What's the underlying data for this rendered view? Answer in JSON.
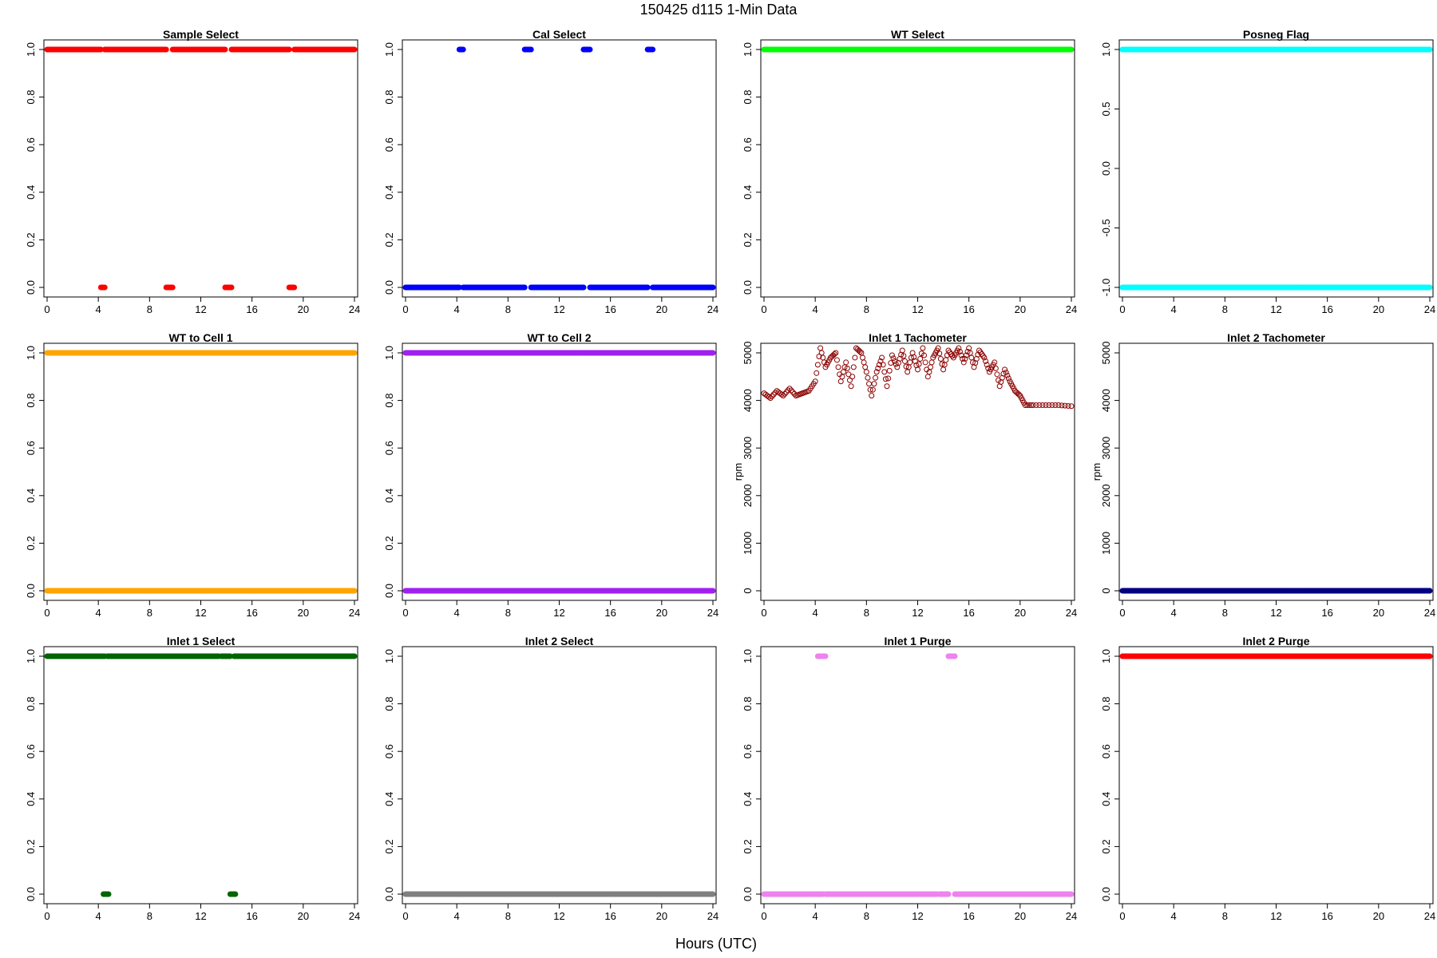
{
  "figure": {
    "title": "150425   d115   1-Min Data",
    "xlabel": "Hours (UTC)"
  },
  "chart_data": [
    {
      "type": "scatter",
      "title": "Sample Select",
      "color": "#ff0000",
      "xlim": [
        0,
        24
      ],
      "ylim": [
        0,
        1
      ],
      "xticks": [
        0,
        4,
        8,
        12,
        16,
        20,
        24
      ],
      "yticks": [
        0.0,
        0.2,
        0.4,
        0.6,
        0.8,
        1.0
      ],
      "ytick_decimals": 1,
      "ylabel": "",
      "segments": [
        {
          "y": 1,
          "x": [
            [
              0,
              4.2
            ],
            [
              4.5,
              9.3
            ],
            [
              9.8,
              13.9
            ],
            [
              14.4,
              18.9
            ],
            [
              19.3,
              24
            ]
          ]
        },
        {
          "y": 0,
          "x": [
            [
              4.2,
              4.5
            ],
            [
              9.3,
              9.8
            ],
            [
              13.9,
              14.4
            ],
            [
              18.9,
              19.3
            ]
          ]
        }
      ]
    },
    {
      "type": "scatter",
      "title": "Cal Select",
      "color": "#0000ff",
      "xlim": [
        0,
        24
      ],
      "ylim": [
        0,
        1
      ],
      "xticks": [
        0,
        4,
        8,
        12,
        16,
        20,
        24
      ],
      "yticks": [
        0.0,
        0.2,
        0.4,
        0.6,
        0.8,
        1.0
      ],
      "ytick_decimals": 1,
      "ylabel": "",
      "segments": [
        {
          "y": 1,
          "x": [
            [
              4.2,
              4.5
            ],
            [
              9.3,
              9.8
            ],
            [
              13.9,
              14.4
            ],
            [
              18.9,
              19.3
            ]
          ]
        },
        {
          "y": 0,
          "x": [
            [
              0,
              4.2
            ],
            [
              4.5,
              9.3
            ],
            [
              9.8,
              13.9
            ],
            [
              14.4,
              18.9
            ],
            [
              19.3,
              24
            ]
          ]
        }
      ]
    },
    {
      "type": "scatter",
      "title": "WT Select",
      "color": "#00ff00",
      "xlim": [
        0,
        24
      ],
      "ylim": [
        0,
        1
      ],
      "xticks": [
        0,
        4,
        8,
        12,
        16,
        20,
        24
      ],
      "yticks": [
        0.0,
        0.2,
        0.4,
        0.6,
        0.8,
        1.0
      ],
      "ytick_decimals": 1,
      "ylabel": "",
      "segments": [
        {
          "y": 1,
          "x": [
            [
              0,
              13.5
            ],
            [
              13.6,
              24
            ]
          ]
        }
      ]
    },
    {
      "type": "scatter",
      "title": "Posneg Flag",
      "color": "#00ffff",
      "xlim": [
        0,
        24
      ],
      "ylim": [
        -1,
        1
      ],
      "xticks": [
        0,
        4,
        8,
        12,
        16,
        20,
        24
      ],
      "yticks": [
        -1.0,
        -0.5,
        0.0,
        0.5,
        1.0
      ],
      "ytick_decimals": 1,
      "ylabel": "",
      "segments": [
        {
          "y": 1,
          "x": [
            [
              0,
              13.5
            ],
            [
              13.6,
              24
            ]
          ]
        },
        {
          "y": -1,
          "x": [
            [
              0,
              13.5
            ],
            [
              13.6,
              24
            ]
          ]
        }
      ]
    },
    {
      "type": "scatter",
      "title": "WT to Cell 1",
      "color": "#ffa500",
      "xlim": [
        0,
        24
      ],
      "ylim": [
        0,
        1
      ],
      "xticks": [
        0,
        4,
        8,
        12,
        16,
        20,
        24
      ],
      "yticks": [
        0.0,
        0.2,
        0.4,
        0.6,
        0.8,
        1.0
      ],
      "ytick_decimals": 1,
      "ylabel": "",
      "segments": [
        {
          "y": 1,
          "x": [
            [
              0,
              13.5
            ],
            [
              13.6,
              24
            ]
          ]
        },
        {
          "y": 0,
          "x": [
            [
              0,
              13.5
            ],
            [
              13.6,
              24
            ]
          ]
        }
      ]
    },
    {
      "type": "scatter",
      "title": "WT to Cell 2",
      "color": "#a020f0",
      "xlim": [
        0,
        24
      ],
      "ylim": [
        0,
        1
      ],
      "xticks": [
        0,
        4,
        8,
        12,
        16,
        20,
        24
      ],
      "yticks": [
        0.0,
        0.2,
        0.4,
        0.6,
        0.8,
        1.0
      ],
      "ytick_decimals": 1,
      "ylabel": "",
      "segments": [
        {
          "y": 1,
          "x": [
            [
              0,
              13.5
            ],
            [
              13.6,
              24
            ]
          ]
        },
        {
          "y": 0,
          "x": [
            [
              0,
              13.5
            ],
            [
              13.6,
              24
            ]
          ]
        }
      ]
    },
    {
      "type": "scatter",
      "title": "Inlet 1 Tachometer",
      "color": "#8b0000",
      "open_points": true,
      "xlim": [
        0,
        24
      ],
      "ylim": [
        0,
        5000
      ],
      "xticks": [
        0,
        4,
        8,
        12,
        16,
        20,
        24
      ],
      "yticks": [
        0,
        1000,
        2000,
        3000,
        4000,
        5000
      ],
      "ytick_decimals": 0,
      "ylabel": "rpm",
      "series_xy": [
        [
          0,
          4150
        ],
        [
          0.5,
          4050
        ],
        [
          1,
          4200
        ],
        [
          1.5,
          4100
        ],
        [
          2,
          4250
        ],
        [
          2.5,
          4100
        ],
        [
          3,
          4150
        ],
        [
          3.5,
          4200
        ],
        [
          4,
          4400
        ],
        [
          4.4,
          5100
        ],
        [
          4.8,
          4700
        ],
        [
          5.2,
          4900
        ],
        [
          5.6,
          5000
        ],
        [
          6,
          4400
        ],
        [
          6.4,
          4800
        ],
        [
          6.8,
          4300
        ],
        [
          7.2,
          5100
        ],
        [
          7.6,
          5000
        ],
        [
          8,
          4600
        ],
        [
          8.4,
          4100
        ],
        [
          8.8,
          4600
        ],
        [
          9.2,
          4900
        ],
        [
          9.6,
          4300
        ],
        [
          10,
          4950
        ],
        [
          10.4,
          4700
        ],
        [
          10.8,
          5050
        ],
        [
          11.2,
          4600
        ],
        [
          11.6,
          5000
        ],
        [
          12,
          4650
        ],
        [
          12.4,
          5100
        ],
        [
          12.8,
          4500
        ],
        [
          13.2,
          4900
        ],
        [
          13.6,
          5100
        ],
        [
          14,
          4650
        ],
        [
          14.4,
          5050
        ],
        [
          14.8,
          4900
        ],
        [
          15.2,
          5100
        ],
        [
          15.6,
          4800
        ],
        [
          16,
          5100
        ],
        [
          16.4,
          4700
        ],
        [
          16.8,
          5050
        ],
        [
          17.2,
          4900
        ],
        [
          17.6,
          4600
        ],
        [
          18,
          4800
        ],
        [
          18.4,
          4300
        ],
        [
          18.8,
          4650
        ],
        [
          19.2,
          4400
        ],
        [
          19.6,
          4200
        ],
        [
          20,
          4100
        ],
        [
          20.4,
          3900
        ],
        [
          21,
          3900
        ],
        [
          22,
          3900
        ],
        [
          23,
          3900
        ],
        [
          24,
          3880
        ]
      ]
    },
    {
      "type": "scatter",
      "title": "Inlet 2 Tachometer",
      "color": "#000080",
      "xlim": [
        0,
        24
      ],
      "ylim": [
        0,
        5000
      ],
      "xticks": [
        0,
        4,
        8,
        12,
        16,
        20,
        24
      ],
      "yticks": [
        0,
        1000,
        2000,
        3000,
        4000,
        5000
      ],
      "ytick_decimals": 0,
      "ylabel": "rpm",
      "segments": [
        {
          "y": 0,
          "x": [
            [
              0,
              13.5
            ],
            [
              13.6,
              24
            ]
          ]
        }
      ]
    },
    {
      "type": "scatter",
      "title": "Inlet 1 Select",
      "color": "#006400",
      "xlim": [
        0,
        24
      ],
      "ylim": [
        0,
        1
      ],
      "xticks": [
        0,
        4,
        8,
        12,
        16,
        20,
        24
      ],
      "yticks": [
        0.0,
        0.2,
        0.4,
        0.6,
        0.8,
        1.0
      ],
      "ytick_decimals": 1,
      "ylabel": "",
      "segments": [
        {
          "y": 1,
          "x": [
            [
              0,
              4.5
            ],
            [
              4.7,
              13.4
            ],
            [
              13.6,
              14.3
            ],
            [
              14.6,
              24
            ]
          ]
        },
        {
          "y": 0,
          "x": [
            [
              4.4,
              4.8
            ],
            [
              14.3,
              14.7
            ]
          ]
        }
      ]
    },
    {
      "type": "scatter",
      "title": "Inlet 2 Select",
      "color": "#808080",
      "xlim": [
        0,
        24
      ],
      "ylim": [
        0,
        1
      ],
      "xticks": [
        0,
        4,
        8,
        12,
        16,
        20,
        24
      ],
      "yticks": [
        0.0,
        0.2,
        0.4,
        0.6,
        0.8,
        1.0
      ],
      "ytick_decimals": 1,
      "ylabel": "",
      "segments": [
        {
          "y": 0,
          "x": [
            [
              0,
              13.5
            ],
            [
              13.6,
              24
            ]
          ]
        }
      ]
    },
    {
      "type": "scatter",
      "title": "Inlet 1 Purge",
      "color": "#ee82ee",
      "xlim": [
        0,
        24
      ],
      "ylim": [
        0,
        1
      ],
      "xticks": [
        0,
        4,
        8,
        12,
        16,
        20,
        24
      ],
      "yticks": [
        0.0,
        0.2,
        0.4,
        0.6,
        0.8,
        1.0
      ],
      "ytick_decimals": 1,
      "ylabel": "",
      "segments": [
        {
          "y": 1,
          "x": [
            [
              4.2,
              4.8
            ],
            [
              14.4,
              14.9
            ]
          ]
        },
        {
          "y": 0,
          "x": [
            [
              0,
              4.6
            ],
            [
              4.8,
              13.5
            ],
            [
              13.7,
              14.4
            ],
            [
              14.9,
              24
            ]
          ]
        }
      ]
    },
    {
      "type": "scatter",
      "title": "Inlet 2 Purge",
      "color": "#ff0000",
      "xlim": [
        0,
        24
      ],
      "ylim": [
        0,
        1
      ],
      "xticks": [
        0,
        4,
        8,
        12,
        16,
        20,
        24
      ],
      "yticks": [
        0.0,
        0.2,
        0.4,
        0.6,
        0.8,
        1.0
      ],
      "ytick_decimals": 1,
      "ylabel": "",
      "segments": [
        {
          "y": 1,
          "x": [
            [
              0,
              13.5
            ],
            [
              13.6,
              24
            ]
          ]
        }
      ]
    }
  ]
}
